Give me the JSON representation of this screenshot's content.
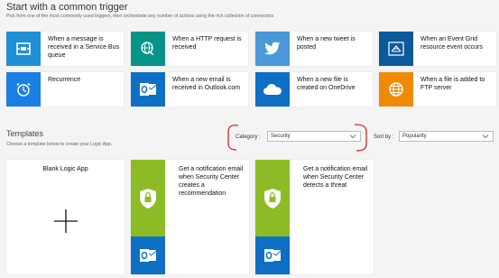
{
  "header": {
    "title": "Start with a common trigger",
    "subtitle": "Pick from one of the most commonly used triggers, then orchestrate any number of actions using the rich collection of connectors"
  },
  "triggers": [
    {
      "label": "When a message is received in a Service Bus queue",
      "icon": "service-bus-icon",
      "color": "#1f8fd6"
    },
    {
      "label": "When a HTTP request is received",
      "icon": "http-globe-icon",
      "color": "#069488"
    },
    {
      "label": "When a new tweet is posted",
      "icon": "twitter-icon",
      "color": "#4a98d8"
    },
    {
      "label": "When an Event Grid resource event occurs",
      "icon": "event-grid-icon",
      "color": "#0b5a9c"
    },
    {
      "label": "Recurrence",
      "icon": "clock-icon",
      "color": "#1a7fe3"
    },
    {
      "label": "When a new email is received in Outlook.com",
      "icon": "outlook-icon",
      "color": "#0e70c4"
    },
    {
      "label": "When a new file is created on OneDrive",
      "icon": "onedrive-icon",
      "color": "#0e6fc4"
    },
    {
      "label": "When a file is added to FTP server",
      "icon": "ftp-globe-icon",
      "color": "#f08a05"
    }
  ],
  "templates_section": {
    "title": "Templates",
    "subtitle": "Choose a template below to create your Logic App.",
    "category_label": "Category :",
    "category_value": "Security",
    "sort_label": "Sort by :",
    "sort_value": "Popularity"
  },
  "template_cards": [
    {
      "title": "Blank Logic App"
    },
    {
      "title": "Get a notification email when Security Center creates a recommendation"
    },
    {
      "title": "Get a notification email when Security Center detects a threat"
    }
  ],
  "colors": {
    "annotation": "#e02424",
    "security_green": "#8dbb25",
    "outlook_blue": "#0e70c4"
  }
}
